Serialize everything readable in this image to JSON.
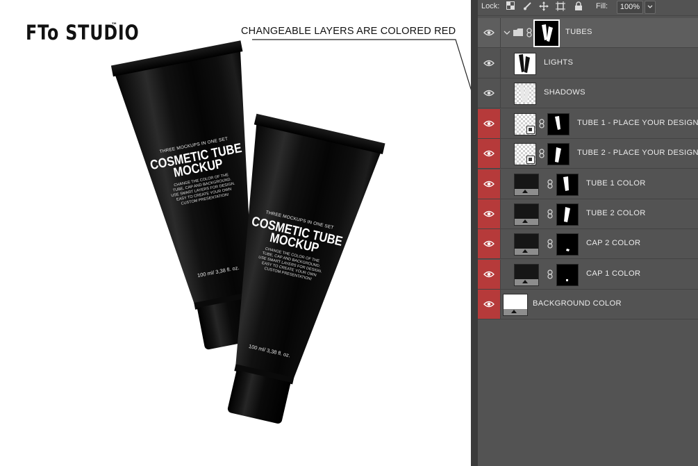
{
  "preview": {
    "brand": "FTo STUDIO",
    "brand_tm": "™",
    "annotation": "CHANGEABLE LAYERS ARE COLORED RED",
    "tube_text": {
      "line1": "THREE MOCKUPS IN ONE SET",
      "title1": "COSMETIC TUBE",
      "title2": "MOCKUP",
      "desc": "CHANGE THE COLOR OF THE TUBE, CAP AND BACKGROUND. USE SMART LAYERS FOR DESIGN. EASY TO CREATE YOUR OWN CUSTOM PRESENTATION!",
      "volume": "100 ml/ 3,38 fl. oz."
    }
  },
  "lockbar": {
    "lock_label": "Lock:",
    "fill_label": "Fill:",
    "fill_value": "100%",
    "icons": [
      "lock-transparent-icon",
      "brush-icon",
      "move-icon",
      "artboard-icon",
      "padlock-icon",
      "chevron-down-icon"
    ]
  },
  "layers": [
    {
      "name": "TUBES",
      "type": "group",
      "red": false,
      "selected": true
    },
    {
      "name": "LIGHTS",
      "type": "pixel",
      "red": false
    },
    {
      "name": "SHADOWS",
      "type": "pixel",
      "red": false
    },
    {
      "name": "TUBE 1 - PLACE YOUR DESIGN",
      "type": "smart-object",
      "red": true
    },
    {
      "name": "TUBE 2 - PLACE YOUR DESIGN",
      "type": "smart-object",
      "red": true
    },
    {
      "name": "TUBE 1 COLOR",
      "type": "fill",
      "red": true
    },
    {
      "name": "TUBE 2 COLOR",
      "type": "fill",
      "red": true
    },
    {
      "name": "CAP 2 COLOR",
      "type": "fill",
      "red": true
    },
    {
      "name": "CAP 1 COLOR",
      "type": "fill",
      "red": true
    },
    {
      "name": "BACKGROUND COLOR",
      "type": "fill",
      "red": true
    }
  ],
  "colors": {
    "changeable_red": "#b63a3a",
    "panel_bg": "#535353"
  }
}
